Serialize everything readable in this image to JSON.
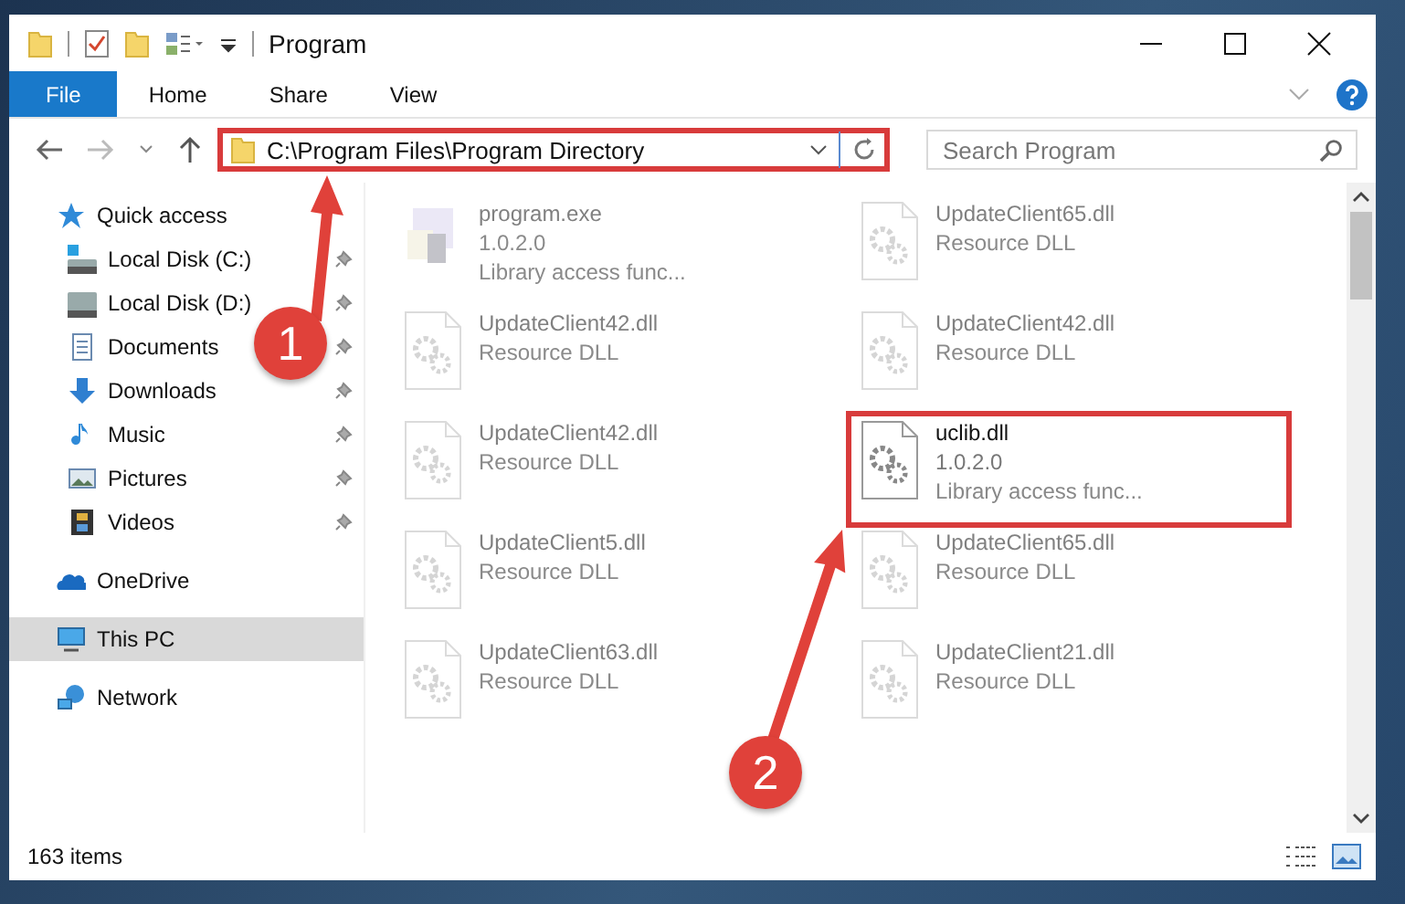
{
  "window": {
    "title": "Program"
  },
  "ribbon": {
    "tabs": [
      {
        "label": "File",
        "selected": true
      },
      {
        "label": "Home",
        "selected": false
      },
      {
        "label": "Share",
        "selected": false
      },
      {
        "label": "View",
        "selected": false
      }
    ]
  },
  "address": {
    "path": "C:\\Program Files\\Program Directory",
    "highlighted": true,
    "callout": "1"
  },
  "search": {
    "placeholder": "Search Program"
  },
  "sidebar": {
    "items": [
      {
        "label": "Quick access",
        "kind": "section",
        "pinned": false,
        "selected": false
      },
      {
        "label": "Local Disk (C:)",
        "kind": "item",
        "pinned": true,
        "selected": false
      },
      {
        "label": "Local Disk (D:)",
        "kind": "item",
        "pinned": true,
        "selected": false
      },
      {
        "label": "Documents",
        "kind": "item",
        "pinned": true,
        "selected": false
      },
      {
        "label": "Downloads",
        "kind": "item",
        "pinned": true,
        "selected": false
      },
      {
        "label": "Music",
        "kind": "item",
        "pinned": true,
        "selected": false
      },
      {
        "label": "Pictures",
        "kind": "item",
        "pinned": true,
        "selected": false
      },
      {
        "label": "Videos",
        "kind": "item",
        "pinned": true,
        "selected": false
      },
      {
        "label": "OneDrive",
        "kind": "section",
        "pinned": false,
        "selected": false
      },
      {
        "label": "This PC",
        "kind": "section",
        "pinned": false,
        "selected": true
      },
      {
        "label": "Network",
        "kind": "section",
        "pinned": false,
        "selected": false
      }
    ]
  },
  "files": [
    {
      "name": "program.exe",
      "kind": "exe",
      "faded": true,
      "highlighted": false,
      "lines": [
        "1.0.2.0",
        "Library access func..."
      ]
    },
    {
      "name": "UpdateClient42.dll",
      "kind": "dll",
      "faded": true,
      "highlighted": false,
      "lines": [
        "Resource DLL"
      ]
    },
    {
      "name": "UpdateClient42.dll",
      "kind": "dll",
      "faded": true,
      "highlighted": false,
      "lines": [
        "Resource DLL"
      ]
    },
    {
      "name": "UpdateClient5.dll",
      "kind": "dll",
      "faded": true,
      "highlighted": false,
      "lines": [
        "Resource DLL"
      ]
    },
    {
      "name": "UpdateClient63.dll",
      "kind": "dll",
      "faded": true,
      "highlighted": false,
      "lines": [
        "Resource DLL"
      ]
    },
    {
      "name": "UpdateClient65.dll",
      "kind": "dll",
      "faded": true,
      "highlighted": false,
      "lines": [
        "Resource DLL"
      ]
    },
    {
      "name": "UpdateClient42.dll",
      "kind": "dll",
      "faded": true,
      "highlighted": false,
      "lines": [
        "Resource DLL"
      ]
    },
    {
      "name": "uclib.dll",
      "kind": "dll",
      "faded": false,
      "highlighted": true,
      "callout": "2",
      "lines": [
        "1.0.2.0",
        "Library access func..."
      ]
    },
    {
      "name": "UpdateClient65.dll",
      "kind": "dll",
      "faded": true,
      "highlighted": false,
      "lines": [
        "Resource DLL"
      ]
    },
    {
      "name": "UpdateClient21.dll",
      "kind": "dll",
      "faded": true,
      "highlighted": false,
      "lines": [
        "Resource DLL"
      ]
    }
  ],
  "status_bar": {
    "count": "163 items"
  }
}
